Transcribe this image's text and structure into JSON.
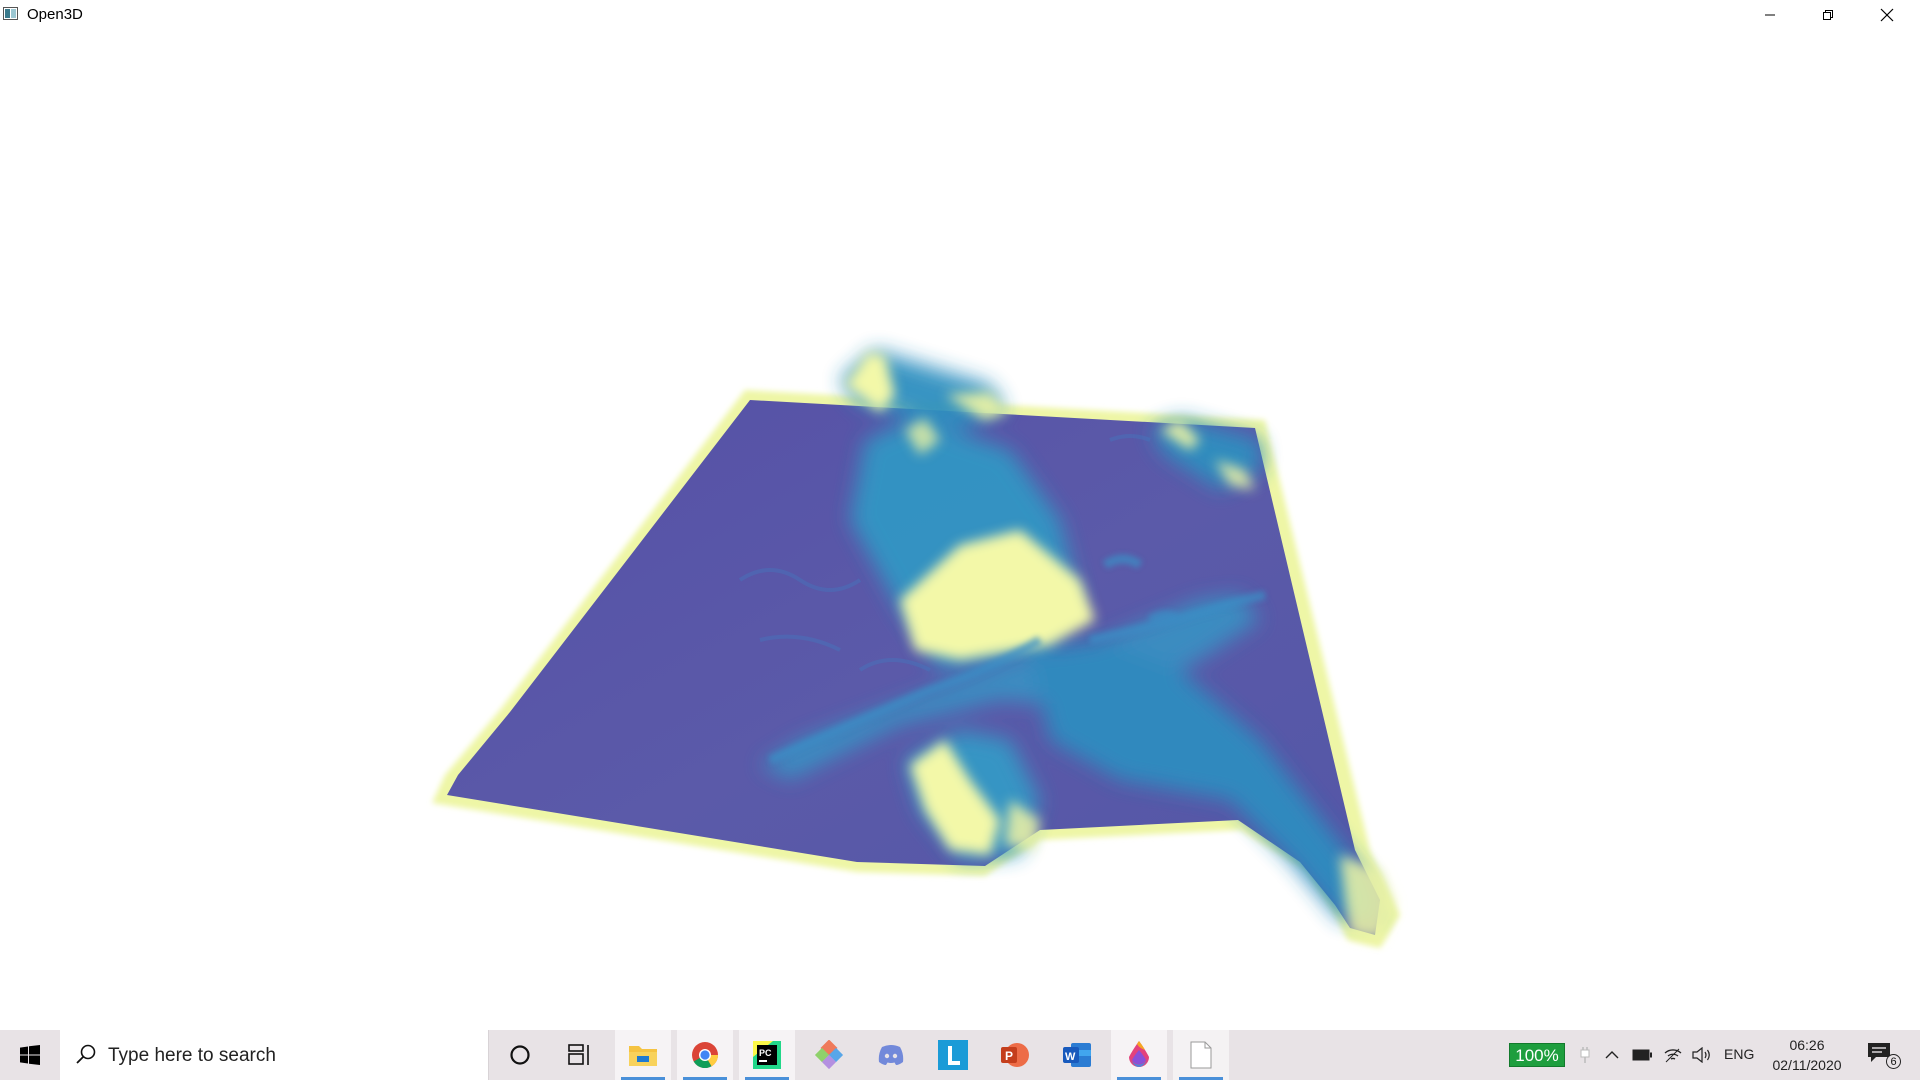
{
  "window": {
    "title": "Open3D",
    "icon": "open3d-app-icon",
    "controls": [
      "minimize-icon",
      "restore-icon",
      "close-icon"
    ]
  },
  "viewport": {
    "content": "3d-terrain-mesh",
    "colors": {
      "low": "#5b58a8",
      "mid": "#2f8fc0",
      "high": "#f2f7a8",
      "edge": "#fbfdb0"
    }
  },
  "taskbar": {
    "start_icon": "windows-start-icon",
    "search": {
      "placeholder": "Type here to search",
      "icon": "search-icon"
    },
    "cortana_icon": "cortana-icon",
    "taskview_icon": "task-view-icon",
    "apps": [
      {
        "name": "file-explorer-icon",
        "active": true
      },
      {
        "name": "chrome-icon",
        "active": true
      },
      {
        "name": "pycharm-icon",
        "active": true
      },
      {
        "name": "git-icon",
        "active": false
      },
      {
        "name": "discord-icon",
        "active": false
      },
      {
        "name": "l-app-icon",
        "active": false
      },
      {
        "name": "powerpoint-icon",
        "active": false
      },
      {
        "name": "word-icon",
        "active": false
      },
      {
        "name": "drop-app-icon",
        "active": true
      },
      {
        "name": "blank-document-icon",
        "active": true
      }
    ],
    "tray": {
      "battery_percent": "100%",
      "language": "ENG",
      "time": "06:26",
      "date": "02/11/2020",
      "notification_count": "6"
    }
  }
}
